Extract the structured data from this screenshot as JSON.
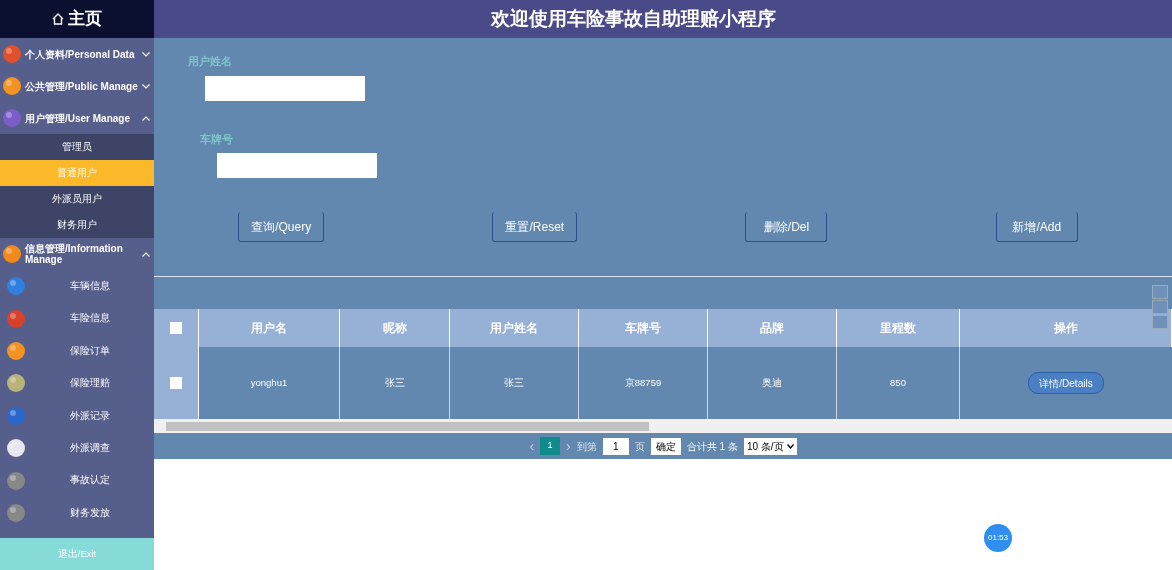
{
  "sidebar": {
    "home": "主页",
    "menus": [
      {
        "label": "个人资料/Personal Data",
        "expanded": false
      },
      {
        "label": "公共管理/Public Manage",
        "expanded": false
      },
      {
        "label": "用户管理/User Manage",
        "expanded": true,
        "children": [
          {
            "label": "管理员",
            "selected": false
          },
          {
            "label": "普通用户",
            "selected": true
          },
          {
            "label": "外派员用户",
            "selected": false
          },
          {
            "label": "财务用户",
            "selected": false
          }
        ]
      },
      {
        "label": "信息管理/Information Manage",
        "expanded": true
      }
    ],
    "items": [
      {
        "label": "车辆信息"
      },
      {
        "label": "车险信息"
      },
      {
        "label": "保险订单"
      },
      {
        "label": "保险理赔"
      },
      {
        "label": "外派记录"
      },
      {
        "label": "外派调查"
      },
      {
        "label": "事故认定"
      },
      {
        "label": "财务发放"
      }
    ],
    "exit": "退出/Exit"
  },
  "header": {
    "title": "欢迎使用车险事故自助理赔小程序"
  },
  "search": {
    "fields": [
      {
        "label": "用户姓名"
      },
      {
        "label": "车牌号"
      }
    ],
    "buttons": [
      "查询/Query",
      "重置/Reset",
      "删除/Del",
      "新增/Add"
    ]
  },
  "table": {
    "all_checked": false,
    "columns": [
      "用户名",
      "昵称",
      "用户姓名",
      "车牌号",
      "品牌",
      "里程数",
      "操作"
    ],
    "rows": [
      {
        "checked": false,
        "cells": [
          "yonghu1",
          "张三",
          "张三",
          "京88759",
          "奥迪",
          "850"
        ],
        "action": "详情/Details"
      }
    ]
  },
  "pagination": {
    "prev": "‹",
    "page": "1",
    "next": "›",
    "goto": "到第",
    "page_input": "1",
    "page_unit": "页",
    "confirm": "确定",
    "total": "合计共 1 条",
    "page_size": "10 条/页"
  },
  "timer": "01:53"
}
